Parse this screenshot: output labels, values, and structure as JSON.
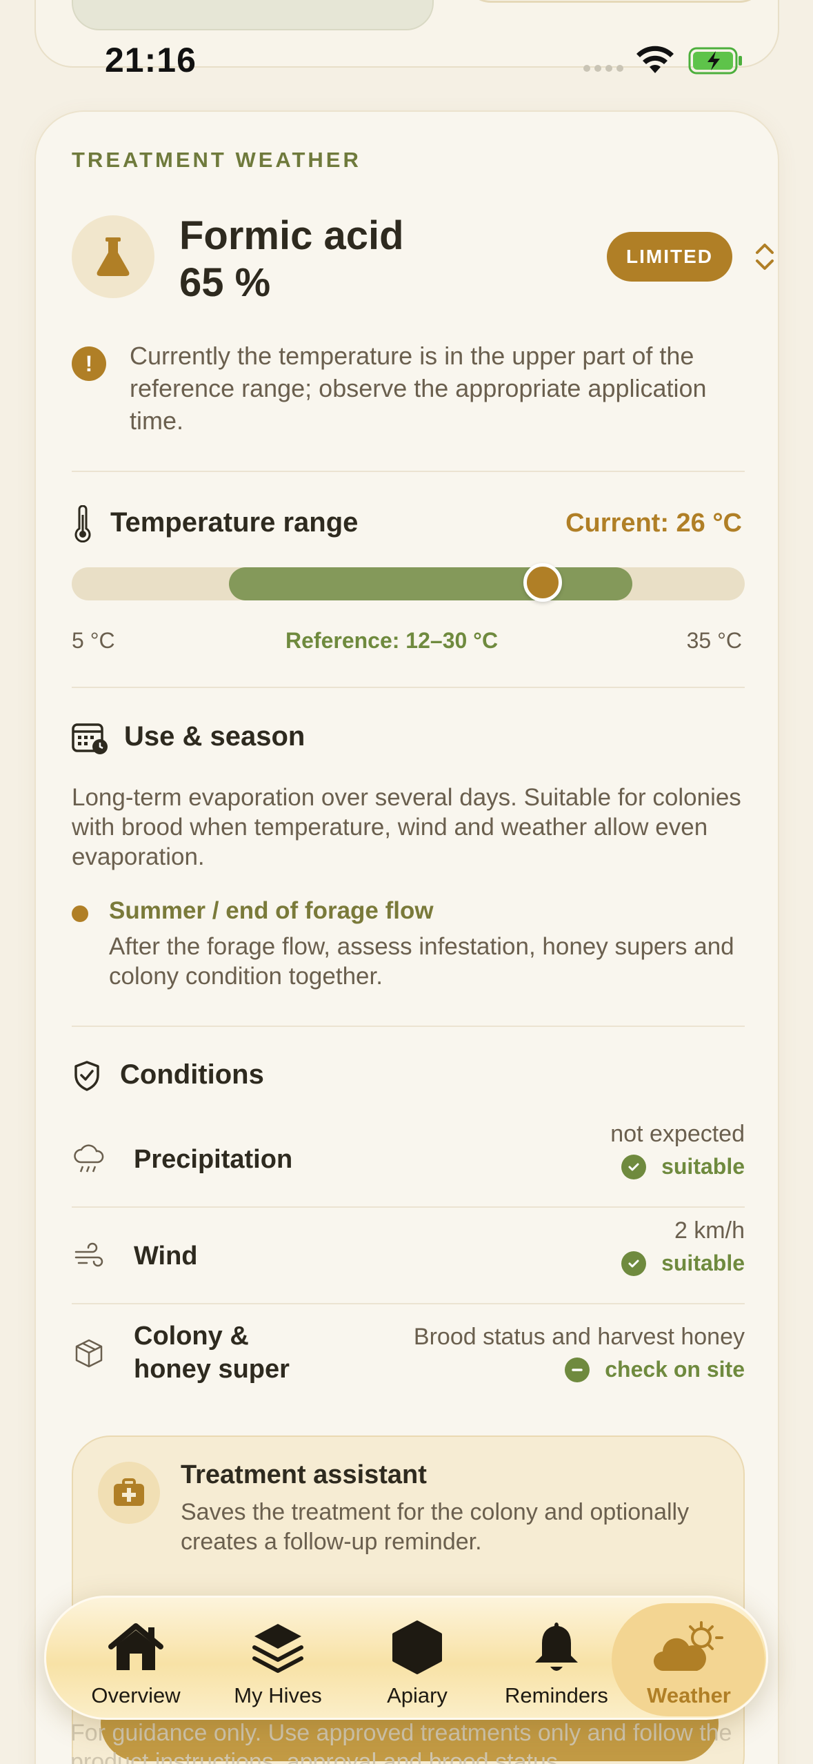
{
  "status_bar": {
    "time": "21:16"
  },
  "card": {
    "eyebrow": "TREATMENT WEATHER",
    "title_line1": "Formic acid",
    "title_line2": "65 %",
    "badge": "LIMITED",
    "warning": "Currently the temperature is in the upper part of the reference range; observe the appropriate application time."
  },
  "temperature": {
    "title": "Temperature range",
    "current_label": "Current: 26 °C",
    "min_label": "5 °C",
    "max_label": "35 °C",
    "reference_label": "Reference: 12–30 °C",
    "scale_min": 5,
    "scale_max": 35,
    "reference_min": 12,
    "reference_max": 30,
    "current_value": 26
  },
  "use_season": {
    "title": "Use & season",
    "description": "Long-term evaporation over several days. Suitable for colonies with brood when temperature, wind and weather allow even evaporation.",
    "season_title": "Summer / end of forage flow",
    "season_text": "After the forage flow, assess infestation, honey supers and colony condition together."
  },
  "conditions": {
    "title": "Conditions",
    "rows": [
      {
        "label": "Precipitation",
        "value": "not expected",
        "status": "suitable",
        "icon": "rain-cloud-icon"
      },
      {
        "label": "Wind",
        "value": "2 km/h",
        "status": "suitable",
        "icon": "wind-icon"
      },
      {
        "label_line1": "Colony &",
        "label_line2": "honey super",
        "value": "Brood status and harvest honey",
        "status": "check on site",
        "icon": "box-icon"
      }
    ]
  },
  "assistant": {
    "title": "Treatment assistant",
    "text": "Saves the treatment for the colony and optionally creates a follow-up reminder."
  },
  "footer": "For guidance only. Use approved treatments only and follow the product instructions, approval and brood status.",
  "tabs": [
    {
      "label": "Overview",
      "icon": "house-icon"
    },
    {
      "label": "My Hives",
      "icon": "layers-icon"
    },
    {
      "label": "Apiary",
      "icon": "hexagon-icon"
    },
    {
      "label": "Reminders",
      "icon": "bell-icon"
    },
    {
      "label": "Weather",
      "icon": "sun-cloud-icon",
      "active": true
    }
  ],
  "colors": {
    "accent": "#b07f26",
    "green": "#84995a",
    "text": "#2e2a1f",
    "muted": "#6a5f4e"
  }
}
